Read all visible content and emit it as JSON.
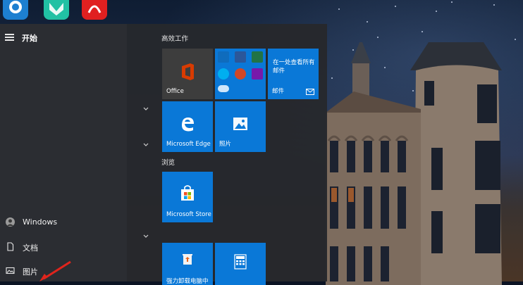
{
  "start_menu": {
    "title": "开始",
    "left_rail": [
      {
        "label": "Windows",
        "icon": "user-avatar-icon"
      },
      {
        "label": "文档",
        "icon": "document-icon"
      },
      {
        "label": "图片",
        "icon": "picture-icon"
      }
    ],
    "groups": [
      {
        "title": "高效工作"
      },
      {
        "title": "浏览"
      }
    ],
    "tiles": {
      "office": {
        "label": "Office"
      },
      "mail": {
        "headline": "在一处查看所有邮件",
        "label": "邮件"
      },
      "edge": {
        "label": "Microsoft Edge"
      },
      "photos": {
        "label": "照片"
      },
      "store": {
        "label": "Microsoft Store"
      },
      "uninstall": {
        "label": "强力卸载电脑中"
      }
    }
  },
  "colors": {
    "tile_blue": "#0a78d7",
    "start_bg": "#26282c",
    "office_tile": "#3d3d3d",
    "office_red": "#d83b01",
    "annotation_red": "#e0241c"
  }
}
